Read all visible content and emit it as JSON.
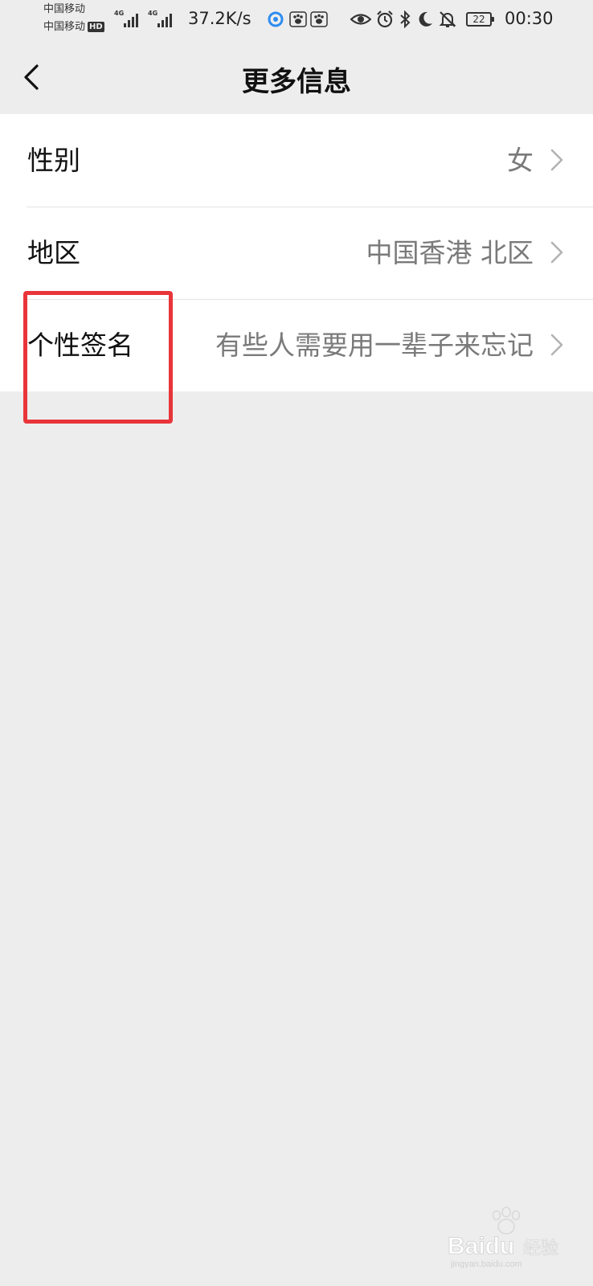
{
  "status_bar": {
    "carrier_1": "中国移动",
    "carrier_2": "中国移动",
    "hd_badge": "HD",
    "network_1": "4G",
    "network_2": "4G",
    "speed": "37.2K/s",
    "battery": "22",
    "time": "00:30",
    "icons": [
      "qq-browser-icon",
      "baidu-app-icon",
      "baidu-app-icon",
      "eye-icon",
      "alarm-icon",
      "bluetooth-icon",
      "moon-icon",
      "mute-bell-icon",
      "battery-icon"
    ]
  },
  "nav": {
    "title": "更多信息",
    "back_icon": "chevron-left-icon"
  },
  "rows": [
    {
      "label": "性别",
      "value": "女",
      "icon": "chevron-right-icon"
    },
    {
      "label": "地区",
      "value": "中国香港 北区",
      "icon": "chevron-right-icon"
    },
    {
      "label": "个性签名",
      "value": "有些人需要用一辈子来忘记",
      "icon": "chevron-right-icon"
    }
  ],
  "highlight_color": "#e8353a",
  "watermark": {
    "brand": "Baidu",
    "suffix": "经验",
    "url": "jingyan.baidu.com"
  }
}
